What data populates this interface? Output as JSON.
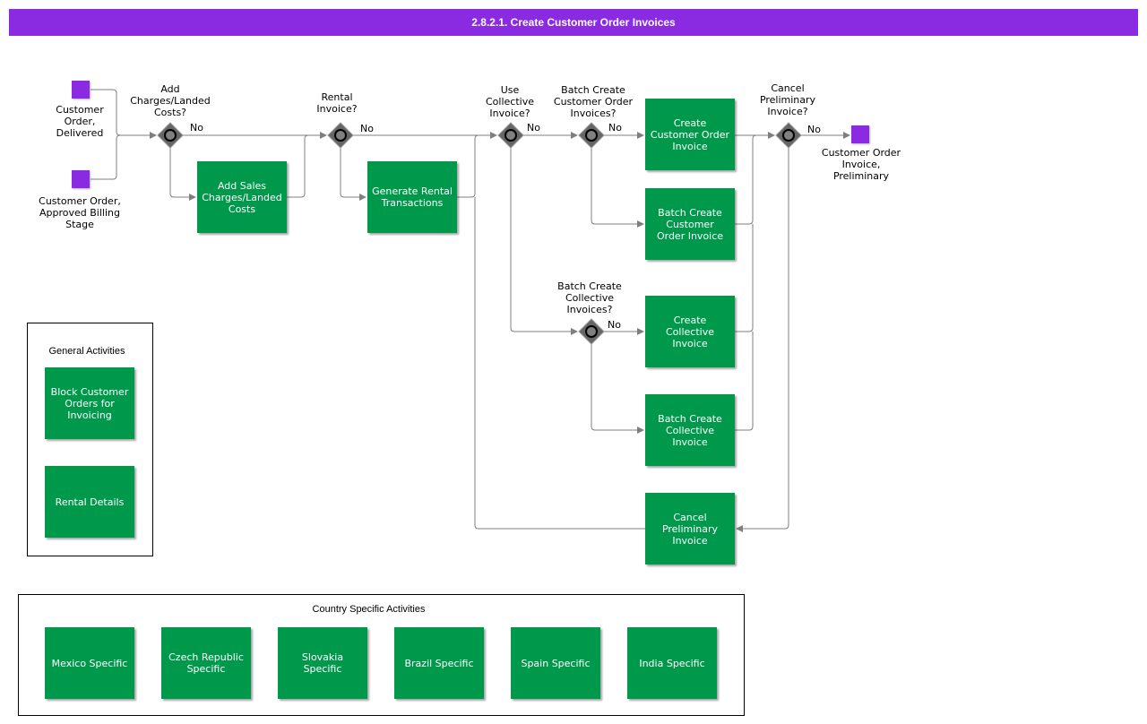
{
  "title": "2.8.2.1. Create Customer Order Invoices",
  "colors": {
    "title_bar": "#8a2be2",
    "activity": "#00994c",
    "event": "#8a2be2",
    "gateway": "#666666",
    "connector": "#7f7f7f"
  },
  "events": {
    "start_delivered": "Customer\nOrder,\nDelivered",
    "start_billing": "Customer Order,\nApproved Billing\nStage",
    "end_preliminary": "Customer Order\nInvoice,\nPreliminary"
  },
  "gateways": {
    "add_charges": "Add\nCharges/Landed\nCosts?",
    "rental_invoice": "Rental\nInvoice?",
    "use_collective": "Use\nCollective\nInvoice?",
    "batch_customer_order": "Batch Create\nCustomer Order\nInvoices?",
    "batch_collective": "Batch Create\nCollective\nInvoices?",
    "cancel_preliminary": "Cancel\nPreliminary\nInvoice?",
    "no_label": "No"
  },
  "activities": {
    "add_sales_charges": "Add Sales\nCharges/Landed\nCosts",
    "generate_rental": "Generate Rental\nTransactions",
    "create_customer_order_invoice": "Create\nCustomer Order\nInvoice",
    "batch_create_customer_order_invoice": "Batch Create\nCustomer\nOrder Invoice",
    "create_collective_invoice": "Create\nCollective\nInvoice",
    "batch_create_collective_invoice": "Batch Create\nCollective\nInvoice",
    "cancel_preliminary_invoice": "Cancel\nPreliminary\nInvoice"
  },
  "general_activities": {
    "title": "General Activities",
    "block_customer_orders": "Block Customer\nOrders for\nInvoicing",
    "rental_details": "Rental Details"
  },
  "country_specific": {
    "title": "Country Specific Activities",
    "mexico": "Mexico Specific",
    "czech": "Czech Republic\nSpecific",
    "slovakia": "Slovakia\nSpecific",
    "brazil": "Brazil Specific",
    "spain": "Spain Specific",
    "india": "India Specific"
  }
}
